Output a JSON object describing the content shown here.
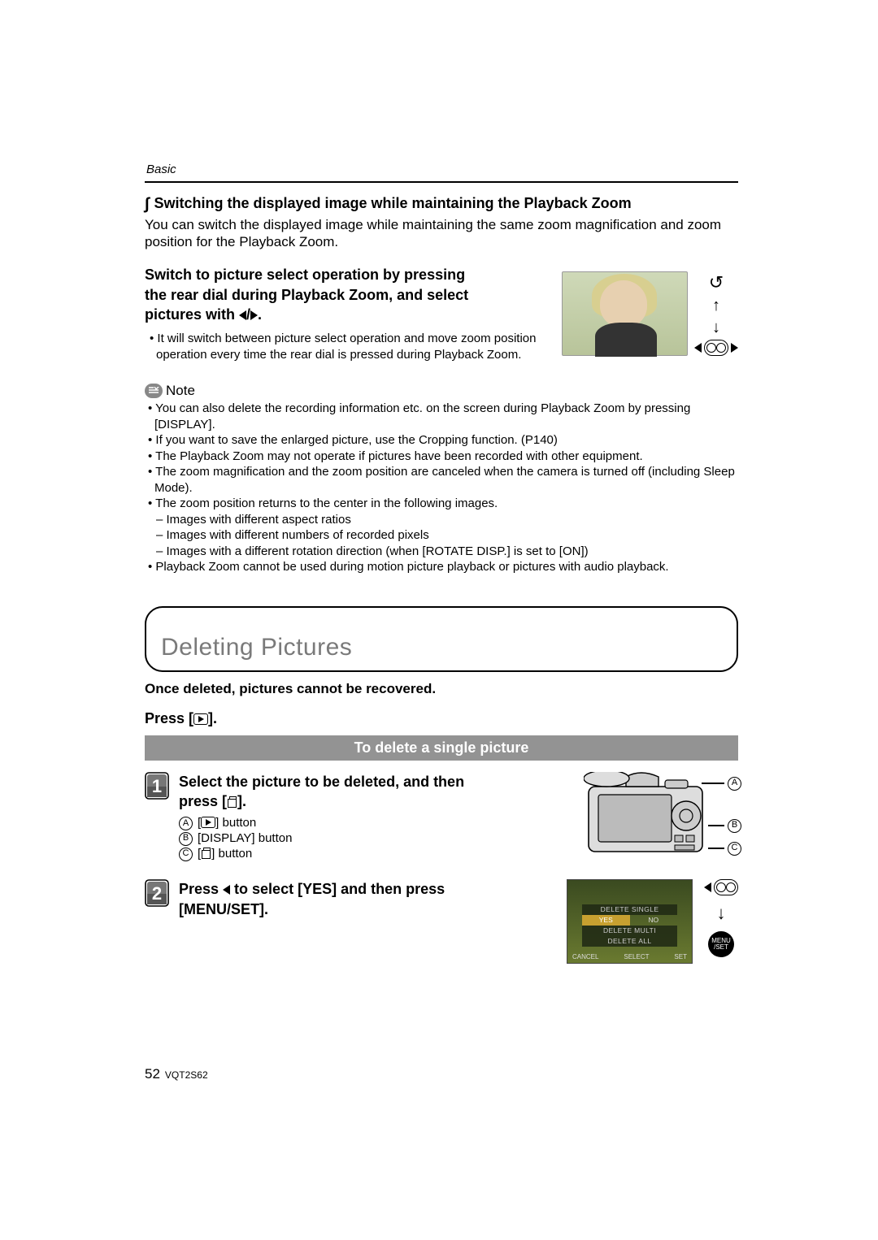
{
  "header": {
    "category": "Basic"
  },
  "switching": {
    "heading": "Switching the displayed image while maintaining the Playback Zoom",
    "body": "You can switch the displayed image while maintaining the same zoom magnification and zoom position for the Playback Zoom.",
    "instruction_l1": "Switch to picture select operation by pressing",
    "instruction_l2": "the rear dial during Playback Zoom, and select",
    "instruction_l3_pre": "pictures with ",
    "instruction_l3_post": ".",
    "bullet": "It will switch between picture select operation and move zoom position operation every time the rear dial is pressed during Playback Zoom."
  },
  "note": {
    "label": "Note",
    "items": [
      "You can also delete the recording information etc. on the screen during Playback Zoom by pressing [DISPLAY].",
      "If you want to save the enlarged picture, use the Cropping function. (P140)",
      "The Playback Zoom may not operate if pictures have been recorded with other equipment.",
      "The zoom magnification and the zoom position are canceled when the camera is turned off (including Sleep Mode).",
      "The zoom position returns to the center in the following images."
    ],
    "subitems": [
      "Images with different aspect ratios",
      "Images with different numbers of recorded pixels",
      "Images with a different rotation direction (when [ROTATE DISP.] is set to [ON])"
    ],
    "last": "Playback Zoom cannot be used during motion picture playback or pictures with audio playback."
  },
  "deleting": {
    "title": "Deleting Pictures",
    "warning": "Once deleted, pictures cannot be recovered.",
    "press_pre": "Press [",
    "press_post": "].",
    "subsection": "To delete a single picture",
    "step1": {
      "title_l1": "Select the picture to be deleted, and then",
      "title_l2_pre": "press [",
      "title_l2_post": "].",
      "annots": {
        "a_pre": "[",
        "a_post": "] button",
        "b": "[DISPLAY] button",
        "c_pre": "[",
        "c_post": "] button"
      },
      "labels": {
        "a": "A",
        "b": "B",
        "c": "C"
      }
    },
    "step2": {
      "title_pre": "Press ",
      "title_mid": " to select [YES] and then press",
      "title_l2": "[MENU/SET].",
      "screen": {
        "delete_single": "DELETE SINGLE",
        "yes": "YES",
        "no": "NO",
        "delete_multi": "DELETE MULTI",
        "delete_all": "DELETE ALL",
        "cancel": "CANCEL",
        "select": "SELECT",
        "set": "SET"
      },
      "menu": "MENU",
      "set": "/SET"
    }
  },
  "footer": {
    "page": "52",
    "docid": "VQT2S62"
  }
}
